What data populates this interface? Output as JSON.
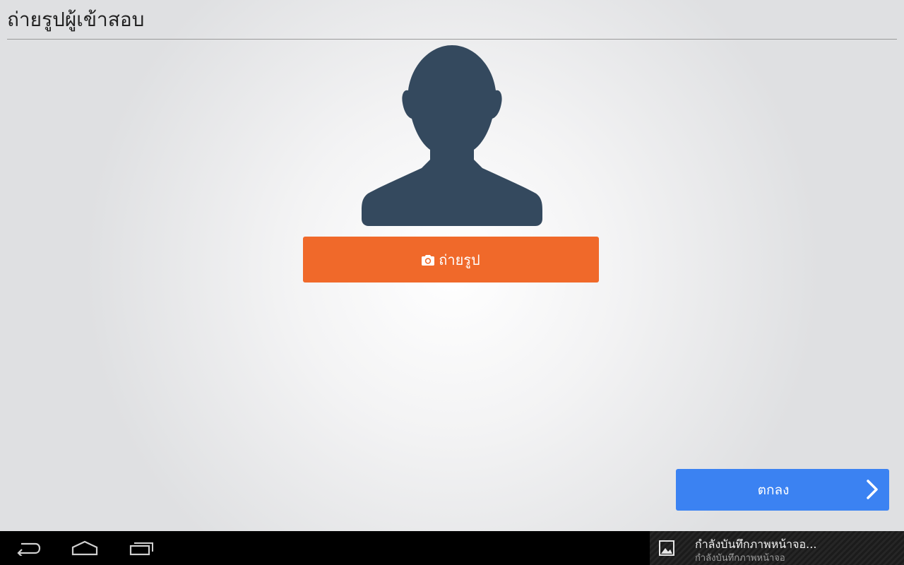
{
  "header": {
    "title": "ถ่ายรูปผู้เข้าสอบ"
  },
  "avatar": {
    "icon": "person-silhouette-icon",
    "color": "#34495e"
  },
  "photo_button": {
    "label": "ถ่ายรูป",
    "icon": "camera-icon",
    "color": "#f0692a"
  },
  "ok_button": {
    "label": "ตกลง",
    "icon": "chevron-right-icon",
    "color": "#3b82f2"
  },
  "system_nav": {
    "back_icon": "back-icon",
    "home_icon": "home-icon",
    "recents_icon": "recent-apps-icon"
  },
  "notification": {
    "icon": "image-icon",
    "title": "กำลังบันทึกภาพหน้าจอ...",
    "subtitle": "กำลังบันทึกภาพหน้าจอ"
  }
}
